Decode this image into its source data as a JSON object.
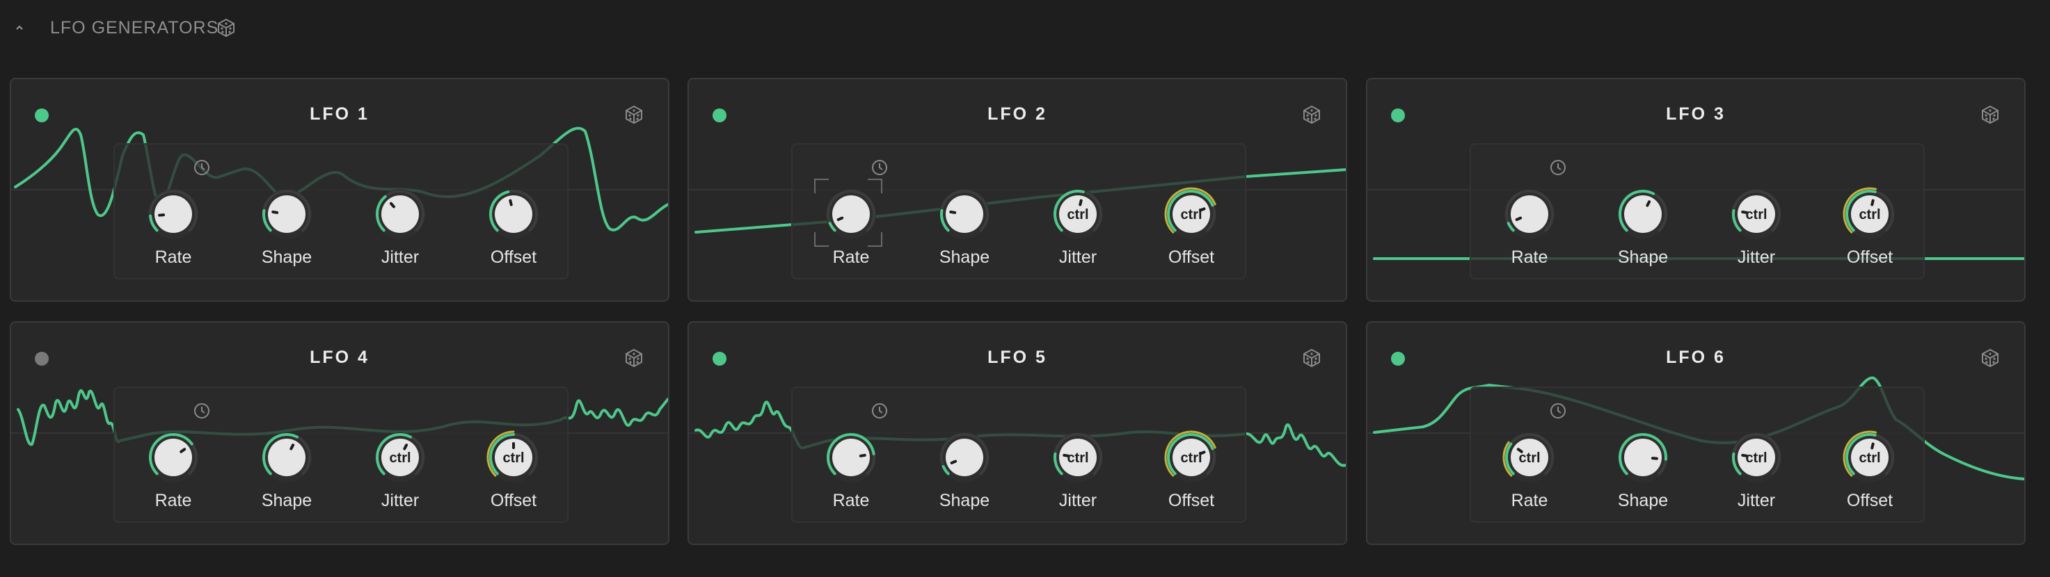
{
  "section": {
    "title": "LFO GENERATORS",
    "collapse_icon": "chevron-up-icon",
    "randomize_icon": "dice-icon"
  },
  "colors": {
    "accent": "#4ec88a",
    "mod_yellow": "#c7b13a",
    "inactive_dot": "#7a7a7a"
  },
  "knob_labels": [
    "Rate",
    "Shape",
    "Jitter",
    "Offset"
  ],
  "lfos": [
    {
      "title": "LFO 1",
      "active": true,
      "knobs": [
        {
          "label": "Rate",
          "value": 0.15,
          "ctrl": ""
        },
        {
          "label": "Shape",
          "value": 0.2,
          "ctrl": ""
        },
        {
          "label": "Jitter",
          "value": 0.35,
          "ctrl": ""
        },
        {
          "label": "Offset",
          "value": 0.45,
          "ctrl": ""
        }
      ]
    },
    {
      "title": "LFO 2",
      "active": true,
      "selected_knob": 0,
      "knobs": [
        {
          "label": "Rate",
          "value": 0.08,
          "ctrl": ""
        },
        {
          "label": "Shape",
          "value": 0.2,
          "ctrl": ""
        },
        {
          "label": "Jitter",
          "value": 0.55,
          "ctrl": "ctrl"
        },
        {
          "label": "Offset",
          "value": 0.75,
          "ctrl": "ctrl",
          "yellow": true
        }
      ]
    },
    {
      "title": "LFO 3",
      "active": true,
      "knobs": [
        {
          "label": "Rate",
          "value": 0.08,
          "ctrl": ""
        },
        {
          "label": "Shape",
          "value": 0.6,
          "ctrl": ""
        },
        {
          "label": "Jitter",
          "value": 0.2,
          "ctrl": "ctrl"
        },
        {
          "label": "Offset",
          "value": 0.55,
          "ctrl": "ctrl",
          "yellow": true
        }
      ]
    },
    {
      "title": "LFO 4",
      "active": false,
      "knobs": [
        {
          "label": "Rate",
          "value": 0.7,
          "ctrl": ""
        },
        {
          "label": "Shape",
          "value": 0.6,
          "ctrl": ""
        },
        {
          "label": "Jitter",
          "value": 0.6,
          "ctrl": "ctrl"
        },
        {
          "label": "Offset",
          "value": 0.5,
          "ctrl": "ctrl",
          "yellow": true
        }
      ]
    },
    {
      "title": "LFO 5",
      "active": true,
      "knobs": [
        {
          "label": "Rate",
          "value": 0.8,
          "ctrl": ""
        },
        {
          "label": "Shape",
          "value": 0.08,
          "ctrl": ""
        },
        {
          "label": "Jitter",
          "value": 0.2,
          "ctrl": "ctrl"
        },
        {
          "label": "Offset",
          "value": 0.75,
          "ctrl": "ctrl",
          "yellow": true
        }
      ]
    },
    {
      "title": "LFO 6",
      "active": true,
      "knobs": [
        {
          "label": "Rate",
          "value": 0.3,
          "ctrl": "ctrl",
          "yellow": true
        },
        {
          "label": "Shape",
          "value": 0.85,
          "ctrl": ""
        },
        {
          "label": "Jitter",
          "value": 0.2,
          "ctrl": "ctrl"
        },
        {
          "label": "Offset",
          "value": 0.55,
          "ctrl": "ctrl",
          "yellow": true
        }
      ]
    }
  ]
}
